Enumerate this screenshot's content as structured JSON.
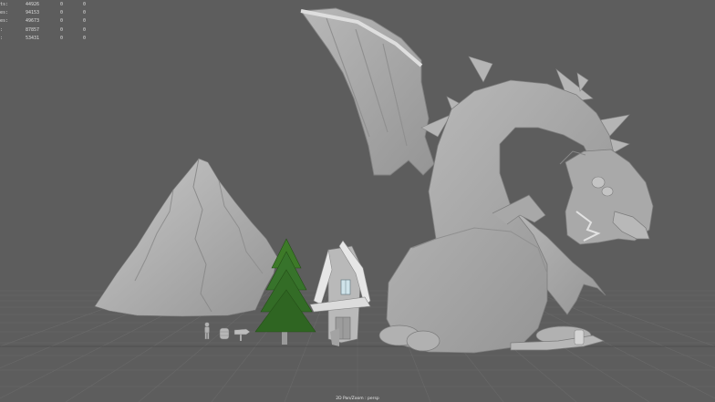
{
  "hud": {
    "rows": [
      {
        "label": "ts:",
        "values": [
          "44926",
          "0",
          "0"
        ]
      },
      {
        "label": "es:",
        "values": [
          "94153",
          "0",
          "0"
        ]
      },
      {
        "label": "es:",
        "values": [
          "49673",
          "0",
          "0"
        ]
      },
      {
        "label": ":",
        "values": [
          "87857",
          "0",
          "0"
        ]
      },
      {
        "label": ":",
        "values": [
          "53431",
          "0",
          "0"
        ]
      }
    ]
  },
  "viewport": {
    "camera_label": "2D Pan/Zoom : persp"
  },
  "colors": {
    "background": "#5d5d5d",
    "grid": "#6a6a6a",
    "model_gray": "#a4a4a4",
    "tree_green": "#2f6b22"
  },
  "scene_objects": [
    "mountain-model",
    "tree-model",
    "house-model",
    "dragon-model",
    "human-reference",
    "barrel-model",
    "signpost-model"
  ]
}
